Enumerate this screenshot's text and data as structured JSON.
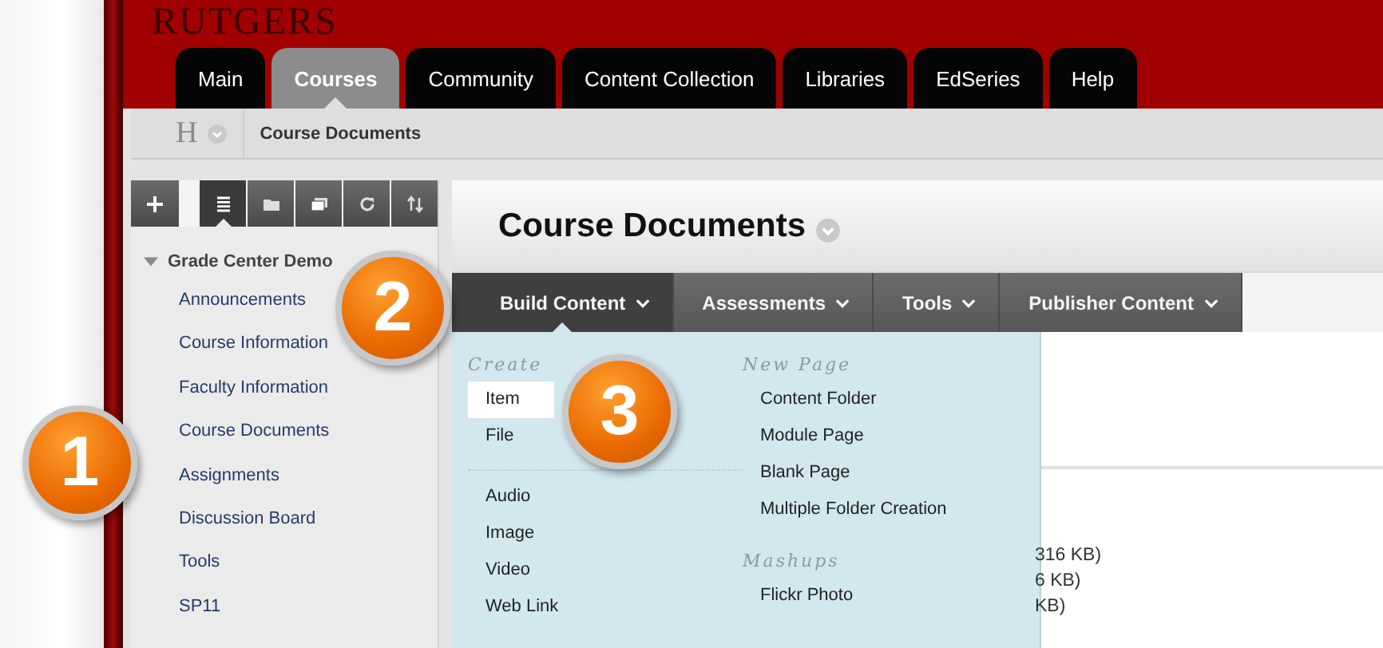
{
  "logo": "RUTGERS",
  "tabs": [
    {
      "label": "Main",
      "selected": false
    },
    {
      "label": "Courses",
      "selected": true
    },
    {
      "label": "Community",
      "selected": false
    },
    {
      "label": "Content Collection",
      "selected": false
    },
    {
      "label": "Libraries",
      "selected": false
    },
    {
      "label": "EdSeries",
      "selected": false
    },
    {
      "label": "Help",
      "selected": false
    }
  ],
  "breadcrumb": {
    "home_letter": "H",
    "current": "Course Documents"
  },
  "course_menu": {
    "toolbar": [
      {
        "kind": "add",
        "selected": false
      },
      {
        "kind": "list",
        "selected": true
      },
      {
        "kind": "folder",
        "selected": false
      },
      {
        "kind": "window",
        "selected": false
      },
      {
        "kind": "refresh",
        "selected": false
      },
      {
        "kind": "sort",
        "selected": false
      }
    ],
    "title": "Grade Center Demo",
    "expanded": true,
    "items": [
      "Announcements",
      "Course Information",
      "Faculty Information",
      "Course Documents",
      "Assignments",
      "Discussion Board",
      "Tools",
      "SP11"
    ]
  },
  "page_title": "Course Documents",
  "action_bar": [
    {
      "label": "Build Content",
      "selected": true
    },
    {
      "label": "Assessments",
      "selected": false
    },
    {
      "label": "Tools",
      "selected": false
    },
    {
      "label": "Publisher Content",
      "selected": false
    }
  ],
  "build_menu": {
    "columns": [
      {
        "sections": [
          {
            "heading": "Create",
            "groups": [
              [
                {
                  "label": "Item",
                  "selected": true
                },
                {
                  "label": "File",
                  "selected": false
                }
              ],
              [
                {
                  "label": "Audio",
                  "selected": false
                },
                {
                  "label": "Image",
                  "selected": false
                },
                {
                  "label": "Video",
                  "selected": false
                },
                {
                  "label": "Web Link",
                  "selected": false
                }
              ]
            ]
          }
        ]
      },
      {
        "sections": [
          {
            "heading": "New Page",
            "groups": [
              [
                {
                  "label": "Content Folder",
                  "selected": false
                },
                {
                  "label": "Module Page",
                  "selected": false
                },
                {
                  "label": "Blank Page",
                  "selected": false
                },
                {
                  "label": "Multiple Folder Creation",
                  "selected": false
                }
              ]
            ]
          },
          {
            "heading": "Mashups",
            "groups": [
              [
                {
                  "label": "Flickr Photo",
                  "selected": false
                }
              ]
            ]
          }
        ]
      }
    ]
  },
  "content_fragments": [
    "316 KB)",
    "6 KB)",
    "KB)"
  ],
  "callouts": [
    "1",
    "2",
    "3"
  ]
}
